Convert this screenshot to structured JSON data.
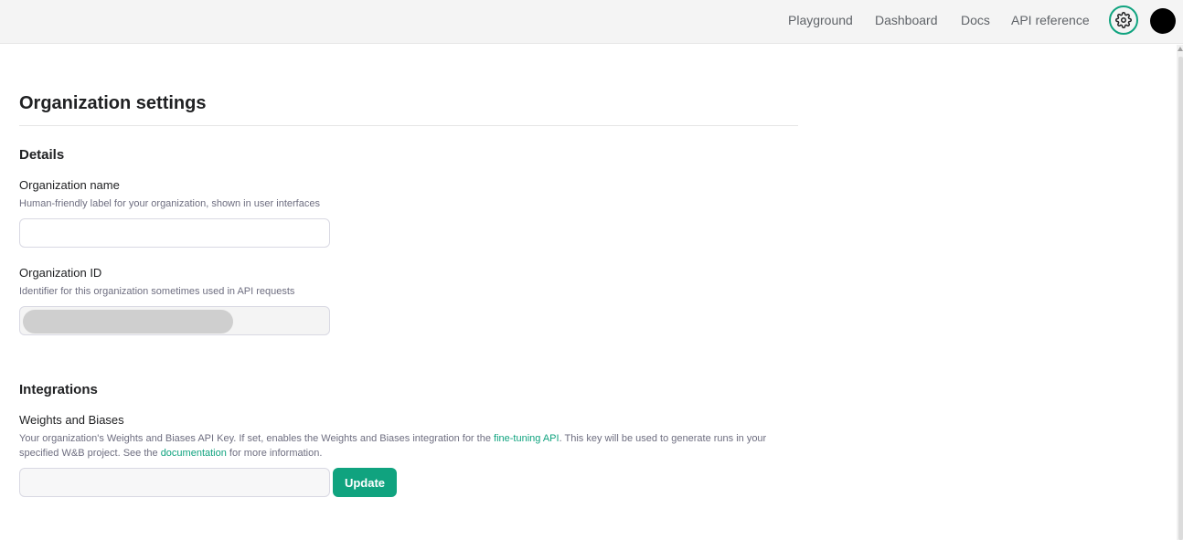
{
  "nav": {
    "playground": "Playground",
    "dashboard": "Dashboard",
    "docs": "Docs",
    "api_reference": "API reference"
  },
  "colors": {
    "accent": "#10a37f",
    "topbar_bg": "#f4f4f4"
  },
  "page": {
    "title": "Organization settings"
  },
  "details": {
    "heading": "Details",
    "org_name": {
      "label": "Organization name",
      "help": "Human-friendly label for your organization, shown in user interfaces",
      "value": ""
    },
    "org_id": {
      "label": "Organization ID",
      "help": "Identifier for this organization sometimes used in API requests"
    }
  },
  "integrations": {
    "heading": "Integrations",
    "wandb": {
      "label": "Weights and Biases",
      "help_part1": "Your organization's Weights and Biases API Key. If set, enables the Weights and Biases integration for the ",
      "help_link1": "fine-tuning API",
      "help_part2": ". This key will be used to generate runs in your specified W&B project. See the ",
      "help_link2": "documentation",
      "help_part3": " for more information.",
      "value": "",
      "update_label": "Update"
    }
  }
}
